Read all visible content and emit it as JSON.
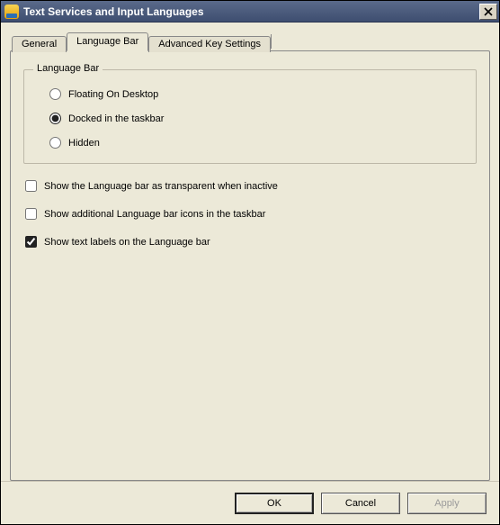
{
  "window": {
    "title": "Text Services and Input Languages"
  },
  "tabs": {
    "general": "General",
    "language_bar": "Language Bar",
    "advanced": "Advanced Key Settings"
  },
  "group": {
    "legend": "Language Bar",
    "radio_floating": "Floating On Desktop",
    "radio_docked": "Docked in the taskbar",
    "radio_hidden": "Hidden",
    "selected": "docked"
  },
  "checks": {
    "transparent": {
      "label": "Show the Language bar as transparent when inactive",
      "checked": false
    },
    "extra_icons": {
      "label": "Show additional Language bar icons in the taskbar",
      "checked": false
    },
    "text_labels": {
      "label": "Show text labels on the Language bar",
      "checked": true
    }
  },
  "buttons": {
    "ok": "OK",
    "cancel": "Cancel",
    "apply": "Apply"
  }
}
